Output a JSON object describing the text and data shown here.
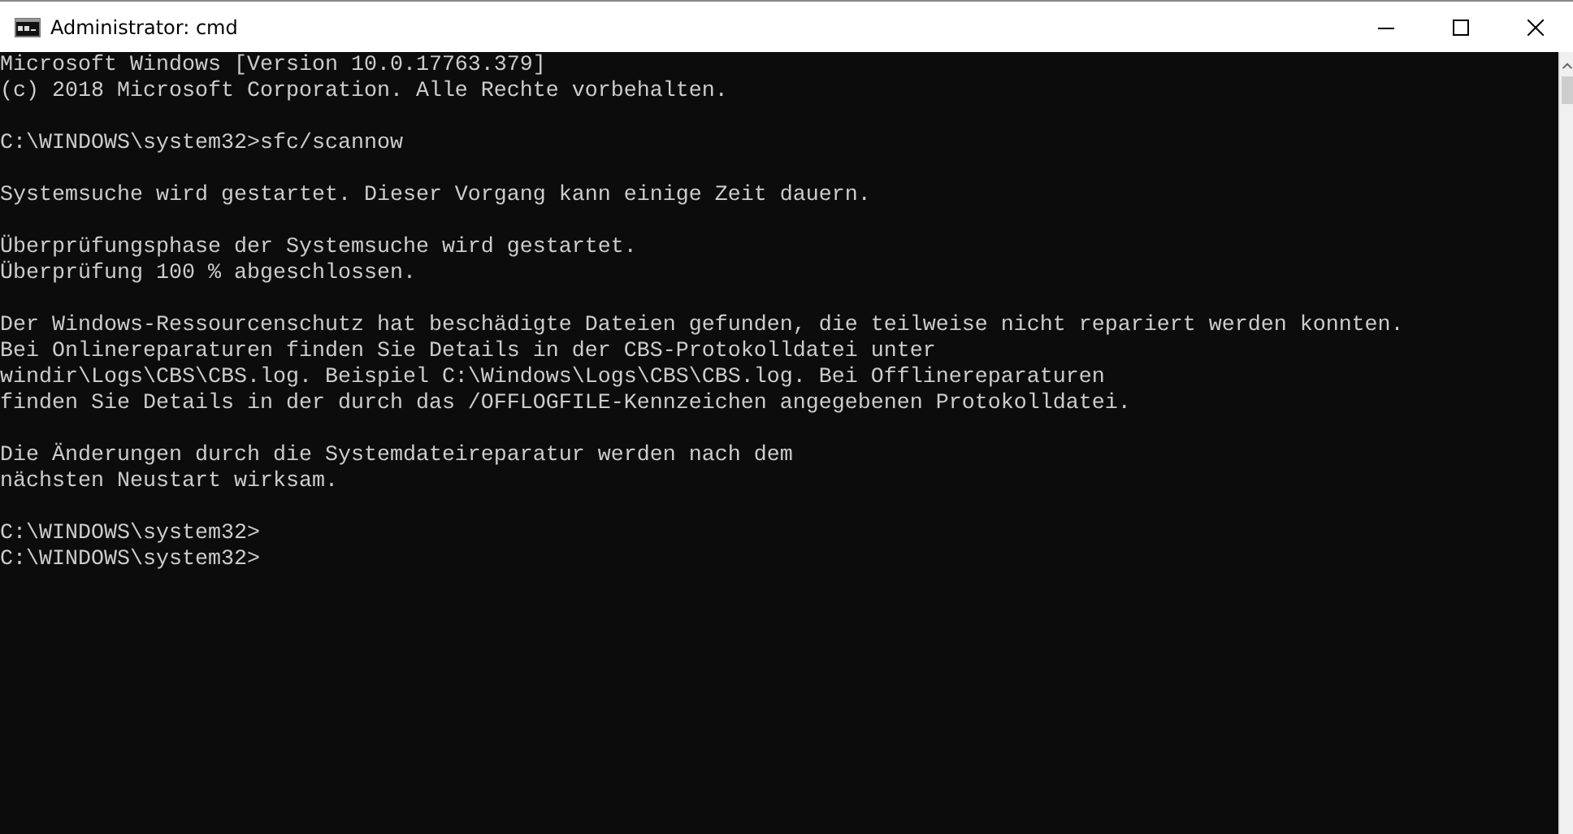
{
  "window": {
    "title": "Administrator: cmd",
    "controls": [
      {
        "kind": "minimize"
      },
      {
        "kind": "maximize"
      },
      {
        "kind": "close"
      }
    ]
  },
  "console": {
    "blocks": [
      [
        "Microsoft Windows [Version 10.0.17763.379]",
        "(c) 2018 Microsoft Corporation. Alle Rechte vorbehalten."
      ],
      [
        "C:\\WINDOWS\\system32>sfc/scannow"
      ],
      [
        "Systemsuche wird gestartet. Dieser Vorgang kann einige Zeit dauern."
      ],
      [
        "Überprüfungsphase der Systemsuche wird gestartet.",
        "Überprüfung 100 % abgeschlossen."
      ],
      [
        "Der Windows-Ressourcenschutz hat beschädigte Dateien gefunden, die teilweise nicht repariert werden konnten.",
        "Bei Onlinereparaturen finden Sie Details in der CBS-Protokolldatei unter",
        "windir\\Logs\\CBS\\CBS.log. Beispiel C:\\Windows\\Logs\\CBS\\CBS.log. Bei Offlinereparaturen",
        "finden Sie Details in der durch das /OFFLOGFILE-Kennzeichen angegebenen Protokolldatei."
      ],
      [
        "Die Änderungen durch die Systemdateireparatur werden nach dem",
        "nächsten Neustart wirksam."
      ],
      [
        "C:\\WINDOWS\\system32>",
        "C:\\WINDOWS\\system32>"
      ]
    ]
  }
}
